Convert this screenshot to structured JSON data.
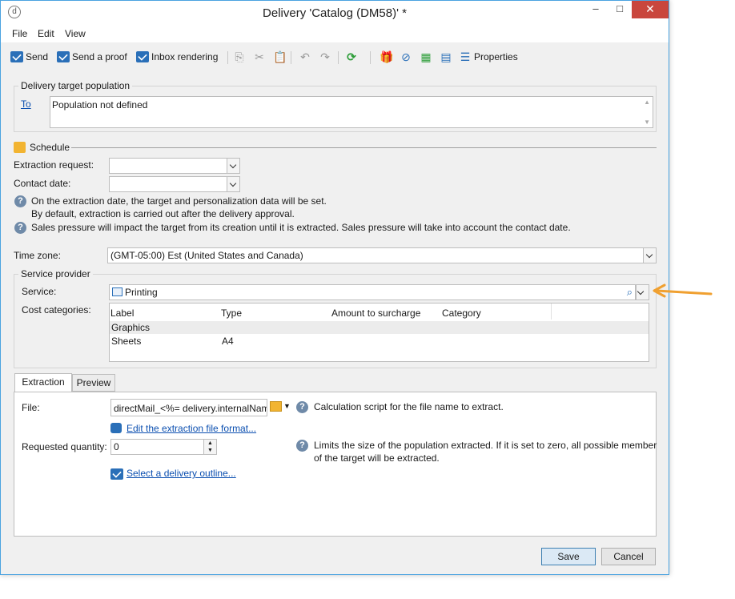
{
  "window": {
    "title": "Delivery 'Catalog (DM58)' *",
    "minimize": "–",
    "maximize": "□",
    "close": "✕"
  },
  "menu": [
    "File",
    "Edit",
    "View"
  ],
  "toolbar": {
    "send": "Send",
    "send_proof": "Send a proof",
    "inbox_rendering": "Inbox rendering",
    "properties": "Properties"
  },
  "target": {
    "legend": "Delivery target population",
    "to_link": "To",
    "population": "Population not defined"
  },
  "schedule": {
    "legend": "Schedule",
    "extraction_request_label": "Extraction request:",
    "extraction_request_value": "",
    "contact_date_label": "Contact date:",
    "contact_date_value": "",
    "note1_line1": "On the extraction date, the target and personalization data will be set.",
    "note1_line2": "By default, extraction is carried out after the delivery approval.",
    "note2": "Sales pressure will impact the target from its creation until it is extracted. Sales pressure will take into account the contact date."
  },
  "timezone": {
    "label": "Time zone:",
    "value": "(GMT-05:00) Est (United States and Canada)"
  },
  "provider": {
    "legend": "Service provider",
    "service_label": "Service:",
    "service_value": "Printing",
    "cost_label": "Cost categories:",
    "columns": [
      "Label",
      "Type",
      "Amount to surcharge",
      "Category"
    ],
    "rows": [
      {
        "label": "Graphics",
        "type": "",
        "amount": "",
        "category": ""
      },
      {
        "label": "Sheets",
        "type": "A4",
        "amount": "",
        "category": ""
      }
    ]
  },
  "tabs": {
    "extraction": "Extraction",
    "preview": "Preview"
  },
  "extraction": {
    "file_label": "File:",
    "file_value": "directMail_<%= delivery.internalNam",
    "file_help": "Calculation script for the file name to extract.",
    "edit_format_link": "Edit the extraction file format...",
    "qty_label": "Requested quantity:",
    "qty_value": "0",
    "qty_help_line1": "Limits the size of the population extracted. If it is set to zero, all possible member",
    "qty_help_line2": "of the target will be extracted.",
    "outline_link": "Select a delivery outline..."
  },
  "buttons": {
    "save": "Save",
    "cancel": "Cancel"
  },
  "colors": {
    "accent_arrow": "#f0a030",
    "link": "#0b4fb0",
    "close_button": "#c9463d"
  }
}
